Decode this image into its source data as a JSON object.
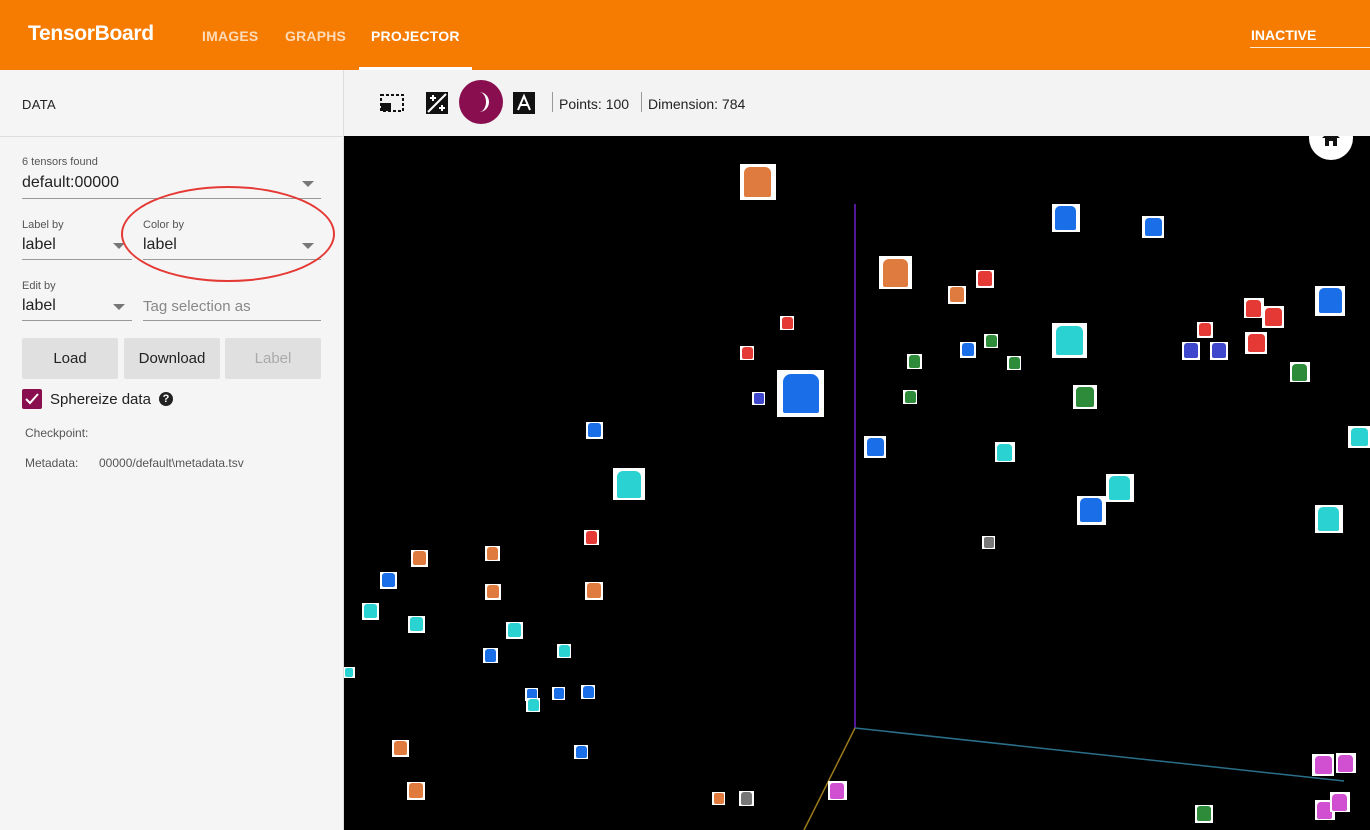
{
  "header": {
    "brand": "TensorBoard",
    "tabs": [
      {
        "label": "IMAGES",
        "active": false
      },
      {
        "label": "GRAPHS",
        "active": false
      },
      {
        "label": "PROJECTOR",
        "active": true
      }
    ],
    "run_status": "INACTIVE",
    "accent_color": "#f57c00"
  },
  "sidebar": {
    "title": "DATA",
    "tensor_count_label": "6 tensors found",
    "tensor_value": "default:00000",
    "label_by": {
      "label": "Label by",
      "value": "label"
    },
    "color_by": {
      "label": "Color by",
      "value": "label"
    },
    "edit_by": {
      "label": "Edit by",
      "value": "label"
    },
    "tag_placeholder": "Tag selection as",
    "buttons": {
      "load": "Load",
      "download": "Download",
      "label": "Label"
    },
    "sphereize": {
      "label": "Sphereize data",
      "checked": true,
      "help_icon": "help-icon"
    },
    "checkpoint_label": "Checkpoint:",
    "metadata_label": "Metadata:",
    "metadata_value": "00000/default\\metadata.tsv"
  },
  "toolbar": {
    "icons": [
      "select-rect-icon",
      "night-mode-icon",
      "moon-icon",
      "label-text-icon"
    ],
    "points": "Points: 100",
    "dimension": "Dimension: 784"
  },
  "canvas": {
    "background": "#000000",
    "home_icon": "home-icon",
    "sprite_colors": {
      "orange": "#e07b3f",
      "blue": "#1a6ee8",
      "cyan": "#2ad2d2",
      "red": "#e53935",
      "green": "#2e8b3a",
      "indigo": "#3f48cc",
      "magenta": "#d14fd1",
      "gray": "#777777"
    }
  }
}
